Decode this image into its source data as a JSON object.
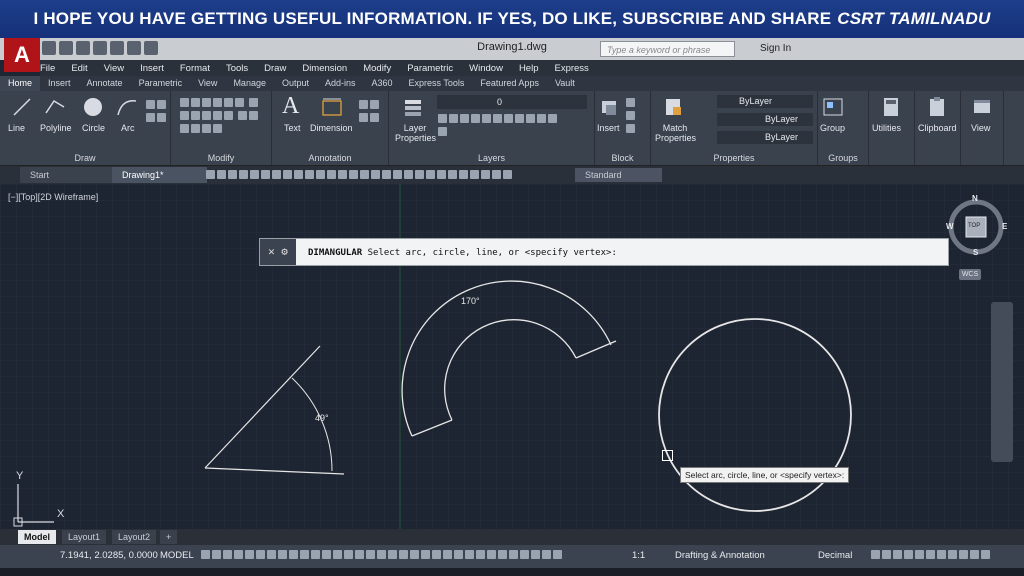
{
  "banner": {
    "text": "I HOPE YOU HAVE GETTING USEFUL INFORMATION. IF YES, DO LIKE, SUBSCRIBE AND SHARE",
    "brand": "CSRT TAMILNADU"
  },
  "app": {
    "logo": "A",
    "document_title": "Drawing1.dwg",
    "search_placeholder": "Type a keyword or phrase",
    "sign_in": "Sign In"
  },
  "menu": [
    "File",
    "Edit",
    "View",
    "Insert",
    "Format",
    "Tools",
    "Draw",
    "Dimension",
    "Modify",
    "Parametric",
    "Window",
    "Help",
    "Express"
  ],
  "ribbon_tabs": [
    "Home",
    "Insert",
    "Annotate",
    "Parametric",
    "View",
    "Manage",
    "Output",
    "Add-ins",
    "A360",
    "Express Tools",
    "Featured Apps",
    "Vault"
  ],
  "ribbon": {
    "draw": {
      "title": "Draw",
      "tools": [
        "Line",
        "Polyline",
        "Circle",
        "Arc"
      ]
    },
    "modify": {
      "title": "Modify"
    },
    "annotation": {
      "title": "Annotation",
      "tools": [
        "Text",
        "Dimension"
      ]
    },
    "layers": {
      "title": "Layers",
      "tool": "Layer Properties",
      "current_layer": "0"
    },
    "block": {
      "title": "Block",
      "tool": "Insert"
    },
    "properties": {
      "title": "Properties",
      "tool": "Match Properties",
      "color": "ByLayer",
      "linetype": "ByLayer",
      "lineweight": "ByLayer"
    },
    "groups": {
      "title": "Groups",
      "tool": "Group"
    },
    "utilities": "Utilities",
    "clipboard": "Clipboard",
    "view": "View"
  },
  "file_tabs": [
    "Start",
    "Drawing1*"
  ],
  "dim_style": "Standard",
  "viewport_label": "[−][Top][2D Wireframe]",
  "command": {
    "name": "DIMANGULAR",
    "prompt": "Select arc, circle, line, or <specify vertex>:"
  },
  "tooltip": "Select arc, circle, line, or <specify vertex>:",
  "dimensions": {
    "angle1": "49°",
    "angle2": "170°"
  },
  "viewcube": {
    "n": "N",
    "s": "S",
    "e": "E",
    "w": "W",
    "top": "TOP",
    "wcs": "WCS"
  },
  "ucs": {
    "x": "X",
    "y": "Y"
  },
  "layout_tabs": [
    "Model",
    "Layout1",
    "Layout2"
  ],
  "status": {
    "coords": "7.1941, 2.0285, 0.0000",
    "space": "MODEL",
    "scale": "1:1",
    "workspace": "Drafting & Annotation",
    "units": "Decimal"
  }
}
